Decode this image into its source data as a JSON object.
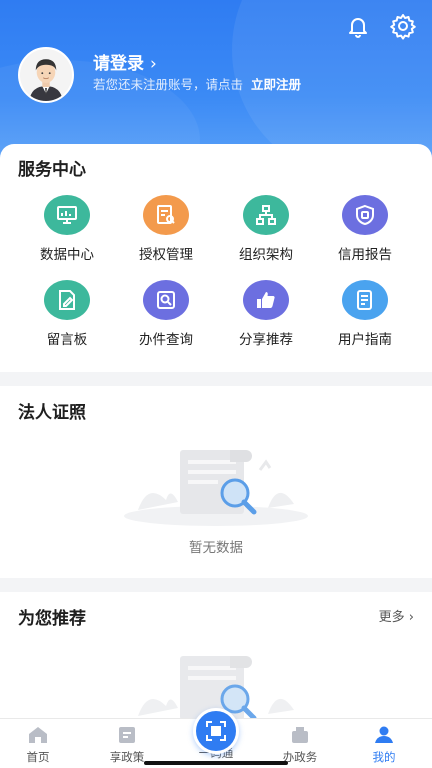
{
  "header": {
    "login_title": "请登录",
    "login_chevron": "›",
    "login_sub": "若您还未注册账号，请点击",
    "register_link": "立即注册",
    "icons": [
      "bell-icon",
      "gear-icon"
    ]
  },
  "service_center": {
    "title": "服务中心",
    "items": [
      {
        "label": "数据中心",
        "icon": "data-center-icon",
        "color": "#3db89c"
      },
      {
        "label": "授权管理",
        "icon": "authorization-icon",
        "color": "#f39a4c"
      },
      {
        "label": "组织架构",
        "icon": "org-structure-icon",
        "color": "#3db89c"
      },
      {
        "label": "信用报告",
        "icon": "credit-report-icon",
        "color": "#6c6fe0"
      },
      {
        "label": "留言板",
        "icon": "message-board-icon",
        "color": "#3db89c"
      },
      {
        "label": "办件查询",
        "icon": "case-query-icon",
        "color": "#6c6fe0"
      },
      {
        "label": "分享推荐",
        "icon": "share-icon",
        "color": "#6c6fe0"
      },
      {
        "label": "用户指南",
        "icon": "user-guide-icon",
        "color": "#4aa3ef"
      }
    ]
  },
  "license": {
    "title": "法人证照",
    "empty_text": "暂无数据"
  },
  "recommend": {
    "title": "为您推荐",
    "more": "更多 ›"
  },
  "tabbar": {
    "tabs": [
      {
        "label": "首页",
        "icon": "home-icon"
      },
      {
        "label": "享政策",
        "icon": "policy-icon"
      },
      {
        "label": "一码通",
        "icon": "qr-code-icon"
      },
      {
        "label": "办政务",
        "icon": "affairs-icon"
      },
      {
        "label": "我的",
        "icon": "profile-icon"
      }
    ],
    "active": "我的"
  }
}
